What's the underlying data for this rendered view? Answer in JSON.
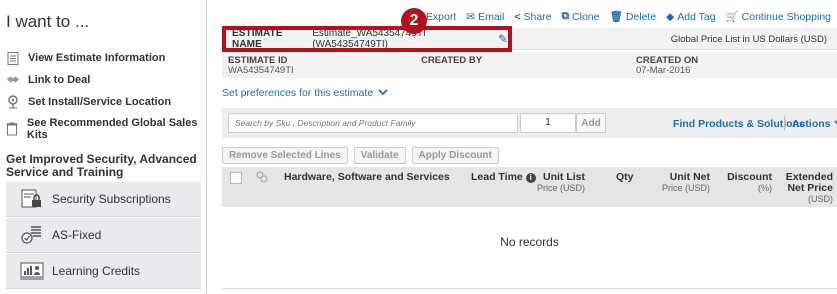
{
  "sidebar": {
    "title": "I want to ...",
    "links": [
      {
        "label": "View Estimate Information",
        "icon": "document-icon"
      },
      {
        "label": "Link to Deal",
        "icon": "handshake-icon"
      },
      {
        "label": "Set Install/Service Location",
        "icon": "location-pin-icon"
      },
      {
        "label": "See Recommended Global Sales Kits",
        "icon": "trash-can-icon"
      }
    ],
    "promo_title": "Get Improved Security, Advanced Service and Training",
    "promo_buttons": [
      {
        "label": "Security Subscriptions",
        "icon": "security-lock-icon"
      },
      {
        "label": "AS-Fixed",
        "icon": "checklist-icon"
      },
      {
        "label": "Learning Credits",
        "icon": "learning-chart-icon"
      }
    ]
  },
  "toolbar": {
    "export": "Export",
    "email": "Email",
    "share": "Share",
    "clone": "Clone",
    "delete": "Delete",
    "add_tag": "Add Tag",
    "continue_shopping": "Continue Shopping"
  },
  "badge": "2",
  "estimate": {
    "name_label": "ESTIMATE NAME",
    "name_value": "Estimate_WA54354749TI (WA54354749TI)",
    "price_list": "Global Price List in US Dollars  (USD)",
    "id_label": "ESTIMATE ID",
    "id_value": "WA54354749TI",
    "created_by_label": "CREATED BY",
    "created_on_label": "CREATED ON",
    "created_on_value": "07-Mar-2016"
  },
  "preferences_link": "Set preferences for this estimate",
  "search": {
    "placeholder": "Search by Sku , Description and Product Family",
    "quantity": "1",
    "add_label": "Add",
    "find_link": "Find Products & Solutions",
    "actions_link": "Actions"
  },
  "line_buttons": {
    "remove": "Remove Selected Lines",
    "validate": "Validate",
    "apply_discount": "Apply Discount"
  },
  "table": {
    "col_item": "Hardware, Software and Services",
    "col_lead": "Lead Time",
    "col_unit_list": "Unit List",
    "col_unit_list_sub": "Price (USD)",
    "col_qty": "Qty",
    "col_unit_net": "Unit Net",
    "col_unit_net_sub": "Price (USD)",
    "col_discount": "Discount",
    "col_discount_sub": "(%)",
    "col_extended": "Extended",
    "col_extended_sub1": "Net Price",
    "col_extended_sub2": "(USD)",
    "empty_text": "No records"
  },
  "colors": {
    "accent_link": "#1a6fb5",
    "highlight_red": "#b3121c"
  }
}
